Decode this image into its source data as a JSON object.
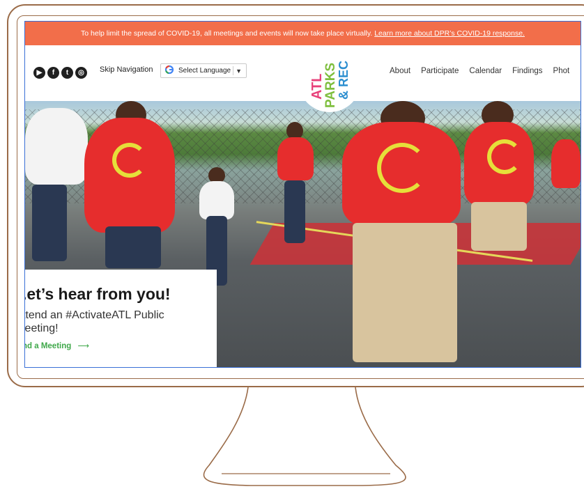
{
  "banner": {
    "text": "To help limit the spread of COVID-19, all meetings and events will now take place virtually.",
    "link": "Learn more about DPR’s COVID-19 response."
  },
  "header": {
    "social": [
      {
        "icon": "youtube-icon",
        "glyph": "▶"
      },
      {
        "icon": "facebook-icon",
        "glyph": "f"
      },
      {
        "icon": "twitter-icon",
        "glyph": "t"
      },
      {
        "icon": "instagram-icon",
        "glyph": "◎"
      }
    ],
    "skip_navigation": "Skip Navigation",
    "language": {
      "label": "Select Language",
      "caret": "▼"
    },
    "logo": {
      "line1": "ATL",
      "line2": "PARKS",
      "line3": "& REC"
    },
    "nav": [
      "About",
      "Participate",
      "Calendar",
      "Findings",
      "Phot"
    ]
  },
  "hero_card": {
    "title": ".et’s hear from you!",
    "subtitle_line1": "ttend an #ActivateATL Public",
    "subtitle_line2": "leeting!",
    "link": "nd a Meeting",
    "link_arrow": "⟶"
  },
  "colors": {
    "banner": "#f26e4a",
    "link_green": "#3fa84a",
    "logo_pink": "#e8417a",
    "logo_green": "#7fbf3f",
    "logo_blue": "#2d8fd0",
    "frame": "#9a6b48"
  }
}
